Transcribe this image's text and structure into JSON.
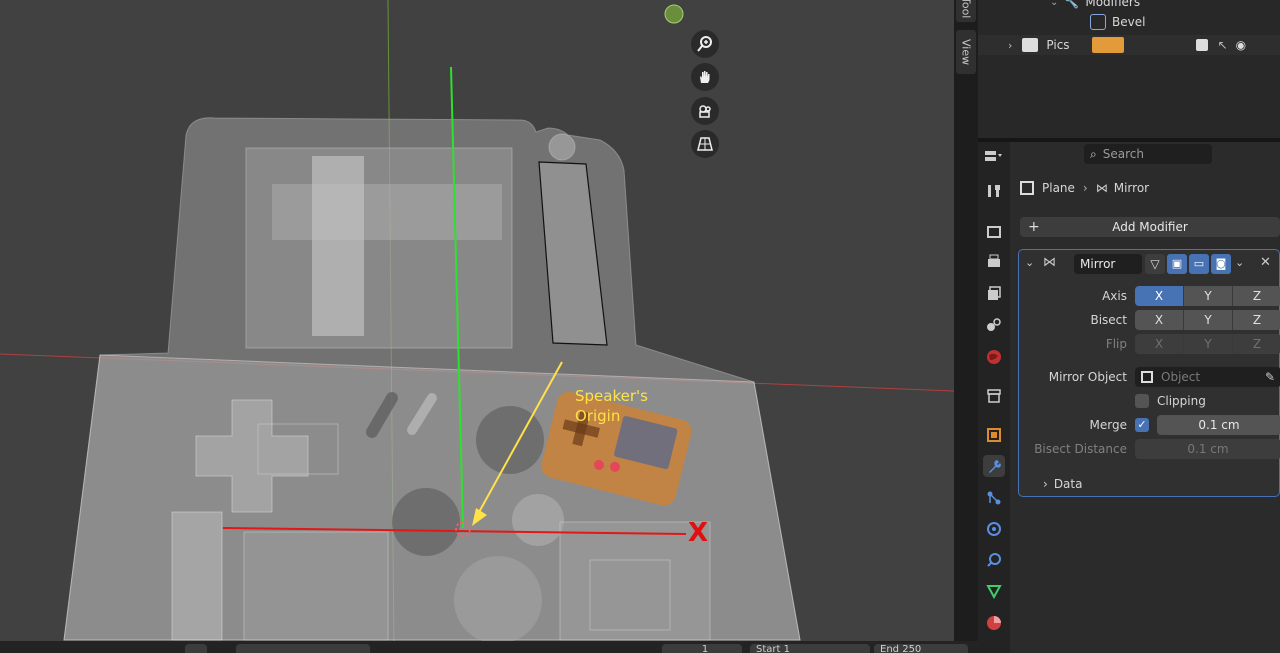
{
  "viewport": {
    "annotation": {
      "line1": "Speaker's",
      "line2": "Origin",
      "color": "#ffe14a"
    },
    "axis_label": "X",
    "nav_icons": [
      "zoom-icon",
      "hand-pan-icon",
      "camera-icon",
      "grid-perspective-icon"
    ]
  },
  "sidetabs": {
    "tool": "Tool",
    "view": "View"
  },
  "outliner": {
    "modifiers_label": "Modifiers",
    "bevel_label": "Bevel",
    "pics_label": "Pics"
  },
  "properties": {
    "search_placeholder": "Search",
    "breadcrumb": {
      "object": "Plane",
      "modifier": "Mirror"
    },
    "add_modifier": "Add Modifier",
    "modifier": {
      "name": "Mirror",
      "axis_label": "Axis",
      "bisect_label": "Bisect",
      "flip_label": "Flip",
      "axes": [
        "X",
        "Y",
        "Z"
      ],
      "axis_active": "X",
      "mirror_object_label": "Mirror Object",
      "mirror_object_placeholder": "Object",
      "clipping_label": "Clipping",
      "merge_label": "Merge",
      "merge_value": "0.1 cm",
      "bisect_distance_label": "Bisect Distance",
      "bisect_distance_value": "0.1 cm",
      "data_label": "Data"
    }
  },
  "timeline": {
    "start_label": "Start",
    "start_value": "1",
    "end_label": "End",
    "end_value": "250",
    "current_frame": "1"
  },
  "colors": {
    "accent": "#4772b3",
    "panel": "#2b2b2b",
    "viewport": "#414141"
  }
}
